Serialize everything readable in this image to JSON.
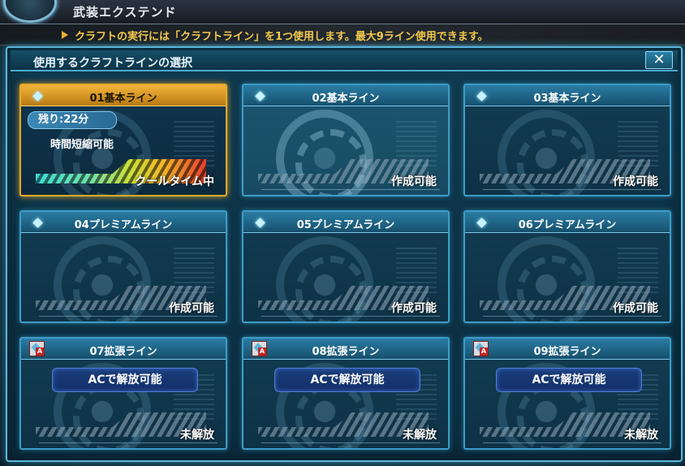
{
  "header": {
    "title": "武装エクステンド",
    "notice": "クラフトの実行には「クラフトライン」を1つ使用します。最大9ライン使用できます。"
  },
  "panel": {
    "title": "使用するクラフトラインの選択",
    "close_label": "✕"
  },
  "lines": [
    {
      "title": "01基本ライン",
      "status": "クールタイム中",
      "remaining": "残り:22分",
      "note": "時間短縮可能"
    },
    {
      "title": "02基本ライン",
      "status": "作成可能"
    },
    {
      "title": "03基本ライン",
      "status": "作成可能"
    },
    {
      "title": "04プレミアムライン",
      "status": "作成可能"
    },
    {
      "title": "05プレミアムライン",
      "status": "作成可能"
    },
    {
      "title": "06プレミアムライン",
      "status": "作成可能"
    },
    {
      "title": "07拡張ライン",
      "status": "未解放",
      "button": "ACで解放可能"
    },
    {
      "title": "08拡張ライン",
      "status": "未解放",
      "button": "ACで解放可能"
    },
    {
      "title": "09拡張ライン",
      "status": "未解放",
      "button": "ACで解放可能"
    }
  ],
  "icons": {
    "ac_badge": "A"
  },
  "colors": {
    "active_border": "#e7a928",
    "card_border": "#3d9cc8",
    "notice_text": "#f4c94c"
  }
}
